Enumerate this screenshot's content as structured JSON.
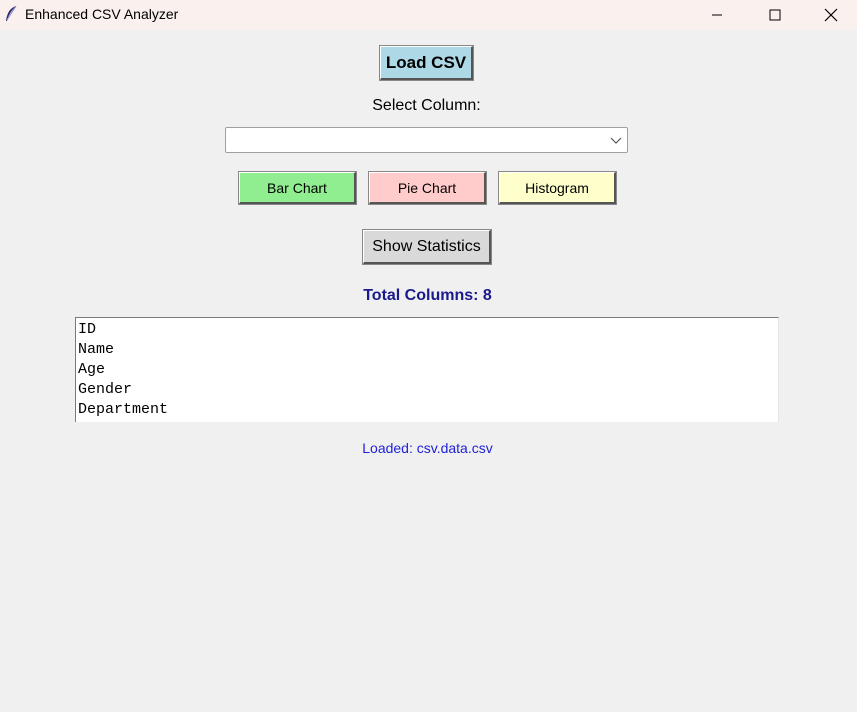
{
  "window": {
    "title": "Enhanced CSV Analyzer",
    "icon": "feather-icon",
    "controls": [
      "minimize-icon",
      "maximize-icon",
      "close-icon"
    ]
  },
  "toolbar": {
    "load_label": "Load CSV"
  },
  "column_select": {
    "label": "Select Column:",
    "value": ""
  },
  "chart_buttons": {
    "bar_label": "Bar Chart",
    "pie_label": "Pie Chart",
    "hist_label": "Histogram"
  },
  "stats_button": {
    "label": "Show Statistics"
  },
  "columns": {
    "total_label": "Total Columns: 8",
    "items": [
      "ID",
      "Name",
      "Age",
      "Gender",
      "Department"
    ]
  },
  "status": {
    "text": "Loaded: csv.data.csv"
  },
  "colors": {
    "load_button": "#add8e6",
    "bar_button": "#90ee90",
    "pie_button": "#ffcccb",
    "hist_button": "#ffffcc",
    "stats_button": "#d9d9d9",
    "total_text": "#1a1a8c",
    "status_text": "#1f1fd6",
    "background": "#f0f0f0",
    "titlebar": "#faf0ee"
  }
}
